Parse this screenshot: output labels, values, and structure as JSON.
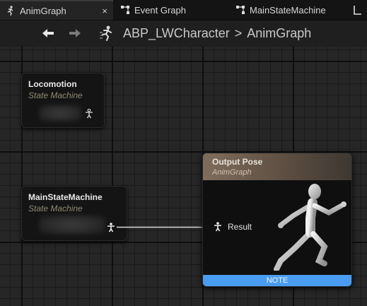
{
  "tabs": [
    {
      "label": "AnimGraph",
      "icon": "anim-graph-icon",
      "active": true,
      "close": "×"
    },
    {
      "label": "Event Graph",
      "icon": "event-graph-icon",
      "active": false
    },
    {
      "label": "MainStateMachine",
      "icon": "state-machine-icon",
      "active": false
    },
    {
      "label": "L",
      "icon": "state-machine-icon",
      "active": false
    }
  ],
  "breadcrumb": {
    "back_icon": "arrow-left-icon",
    "forward_icon": "arrow-right-icon",
    "blueprint": "ABP_LWCharacter",
    "separator": ">",
    "graph": "AnimGraph"
  },
  "nodes": {
    "locomotion": {
      "title": "Locomotion",
      "subtitle": "State Machine"
    },
    "main_state_machine": {
      "title": "MainStateMachine",
      "subtitle": "State Machine"
    },
    "output_pose": {
      "title": "Output Pose",
      "subtitle": "AnimGraph",
      "pin_label": "Result",
      "note": "NOTE"
    }
  },
  "colors": {
    "note_bar": "#4a9cf0",
    "output_header": "#7f6d5c",
    "graph_bg": "#262626",
    "node_bg": "#141414"
  }
}
